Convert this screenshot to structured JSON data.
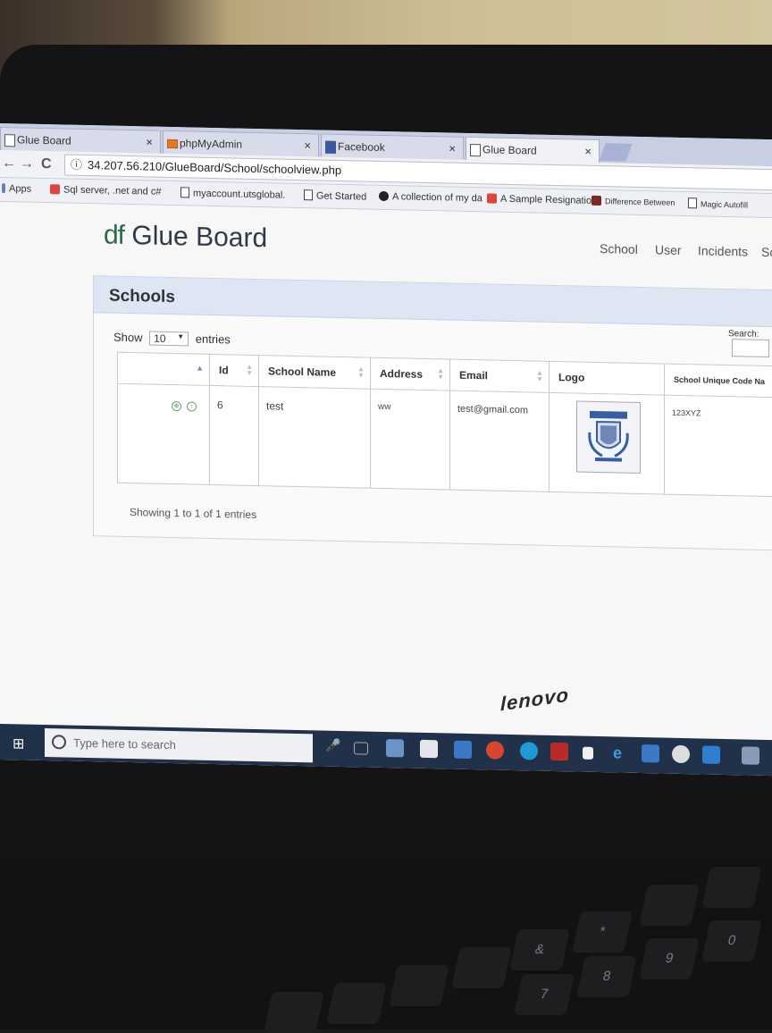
{
  "browser": {
    "tabs": [
      {
        "title": "Glue Board",
        "close": "×"
      },
      {
        "title": "phpMyAdmin",
        "close": "×"
      },
      {
        "title": "Facebook",
        "close": "×"
      },
      {
        "title": "Glue Board",
        "close": "×"
      }
    ],
    "back": "←",
    "forward": "→",
    "reload": "C",
    "info": "ⓘ",
    "url": "34.207.56.210/GlueBoard/School/schoolview.php",
    "bookmarks": [
      {
        "label": "Apps",
        "icon": "apps-icon"
      },
      {
        "label": "Sql server, .net and c#",
        "icon": "bookmark-icon"
      },
      {
        "label": "myaccount.utsglobal.",
        "icon": "page-icon"
      },
      {
        "label": "Get Started",
        "icon": "page-icon"
      },
      {
        "label": "A collection of my da",
        "icon": "bookmark-icon"
      },
      {
        "label": "A Sample Resignatio",
        "icon": "bookmark-icon"
      },
      {
        "label": "Difference Between",
        "icon": "bookmark-icon"
      },
      {
        "label": "Magic Autofill",
        "icon": "page-icon"
      }
    ]
  },
  "site": {
    "brand_prefix": "df",
    "brand_name": "Glue Board",
    "nav": [
      "School",
      "User",
      "Incidents",
      "Sc"
    ]
  },
  "panel": {
    "title": "Schools",
    "show_label": "Show",
    "entries_value": "10",
    "entries_label": "entries",
    "search_label": "Search:",
    "columns": [
      "",
      "Id",
      "School Name",
      "Address",
      "Email",
      "Logo",
      "School Unique Code Na"
    ],
    "rows": [
      {
        "id": "6",
        "school_name": "test",
        "address": "ww",
        "email": "test@gmail.com",
        "unique_code": "123XYZ"
      }
    ],
    "info": "Showing 1 to 1 of 1 entries"
  },
  "taskbar": {
    "search_placeholder": "Type here to search"
  },
  "laptop": {
    "brand": "lenovo"
  },
  "keys": [
    "9",
    "0",
    "8",
    "7",
    "*",
    "&"
  ]
}
